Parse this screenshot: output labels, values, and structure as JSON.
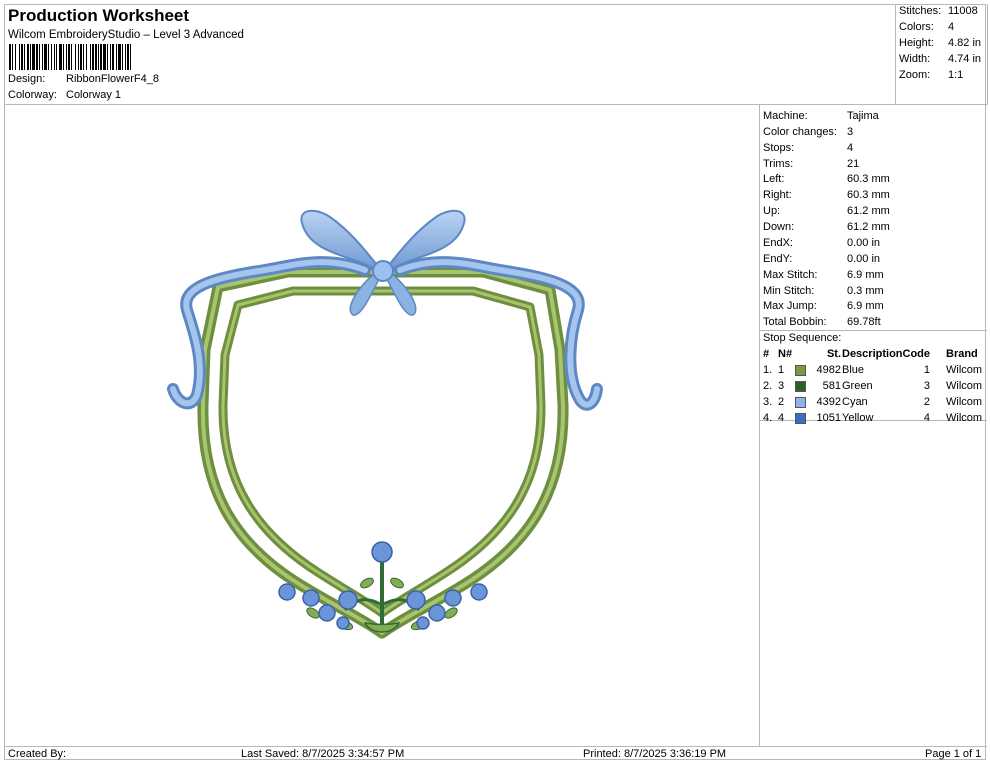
{
  "header": {
    "title": "Production Worksheet",
    "subtitle": "Wilcom EmbroideryStudio – Level 3 Advanced",
    "design_label": "Design:",
    "design_value": "RibbonFlowerF4_8",
    "colorway_label": "Colorway:",
    "colorway_value": "Colorway 1"
  },
  "stats": [
    {
      "label": "Stitches:",
      "value": "11008"
    },
    {
      "label": "Colors:",
      "value": "4"
    },
    {
      "label": "Height:",
      "value": "4.82 in"
    },
    {
      "label": "Width:",
      "value": "4.74 in"
    },
    {
      "label": "Zoom:",
      "value": "1:1"
    }
  ],
  "properties": [
    {
      "label": "Machine:",
      "value": "Tajima"
    },
    {
      "label": "Color changes:",
      "value": "3"
    },
    {
      "label": "Stops:",
      "value": "4"
    },
    {
      "label": "Trims:",
      "value": "21"
    },
    {
      "label": "Left:",
      "value": "60.3 mm"
    },
    {
      "label": "Right:",
      "value": "60.3 mm"
    },
    {
      "label": "Up:",
      "value": "61.2 mm"
    },
    {
      "label": "Down:",
      "value": "61.2 mm"
    },
    {
      "label": "EndX:",
      "value": "0.00 in"
    },
    {
      "label": "EndY:",
      "value": "0.00 in"
    },
    {
      "label": "Max Stitch:",
      "value": "6.9 mm"
    },
    {
      "label": "Min Stitch:",
      "value": "0.3 mm"
    },
    {
      "label": "Max Jump:",
      "value": "6.9 mm"
    },
    {
      "label": "Total Bobbin:",
      "value": "69.78ft"
    }
  ],
  "stop_sequence": {
    "heading": "Stop Sequence:",
    "columns": {
      "num": "#",
      "n": "N#",
      "st": "St.",
      "desc": "Description",
      "code": "Code",
      "brand": "Brand"
    },
    "rows": [
      {
        "num": "1.",
        "n": "1",
        "color": "#7a9a48",
        "st": "4982",
        "desc": "Blue",
        "code": "1",
        "brand": "Wilcom"
      },
      {
        "num": "2.",
        "n": "3",
        "color": "#2e5e2a",
        "st": "581",
        "desc": "Green",
        "code": "3",
        "brand": "Wilcom"
      },
      {
        "num": "3.",
        "n": "2",
        "color": "#8fb2ea",
        "st": "4392",
        "desc": "Cyan",
        "code": "2",
        "brand": "Wilcom"
      },
      {
        "num": "4.",
        "n": "4",
        "color": "#3a6cc8",
        "st": "1051",
        "desc": "Yellow",
        "code": "4",
        "brand": "Wilcom"
      }
    ]
  },
  "footer": {
    "created_by": "Created By:",
    "last_saved": "Last Saved: 8/7/2025 3:34:57 PM",
    "printed": "Printed: 8/7/2025 3:36:19 PM",
    "page": "Page 1 of 1"
  },
  "colors": {
    "frame_green": "#7f9d4c",
    "frame_green_light": "#a7c26c",
    "ribbon_blue": "#8ab3e4",
    "ribbon_blue_dark": "#5d88c4",
    "flower_blue": "#5c86cf",
    "stem_green": "#2f6b34"
  }
}
